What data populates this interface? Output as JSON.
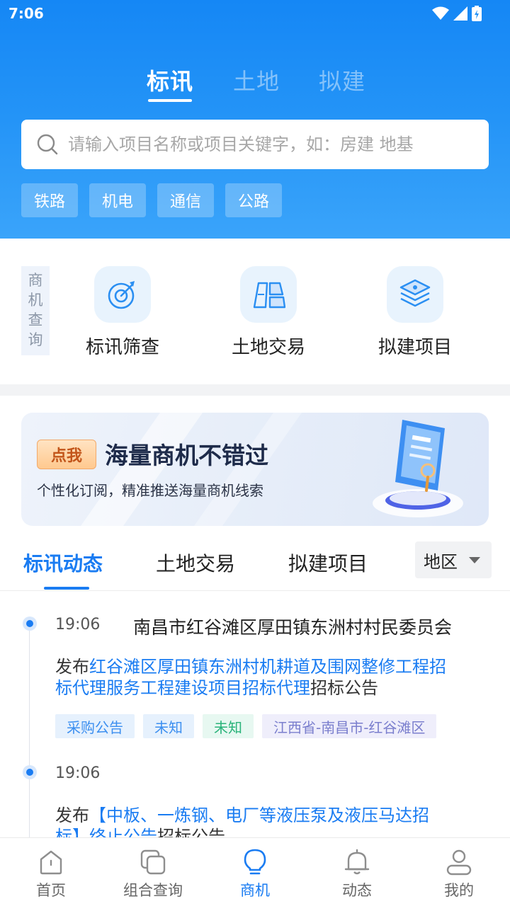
{
  "status_bar": {
    "time": "7:06"
  },
  "top_tabs": [
    {
      "label": "标讯",
      "active": true
    },
    {
      "label": "土地",
      "active": false
    },
    {
      "label": "拟建",
      "active": false
    }
  ],
  "search": {
    "placeholder": "请输入项目名称或项目关键字，如：房建 地基",
    "icon": "search-icon"
  },
  "chips": [
    "铁路",
    "机电",
    "通信",
    "公路"
  ],
  "biz_query": {
    "section_label": "商机查询",
    "features": [
      {
        "label": "标讯筛查",
        "icon": "target-icon"
      },
      {
        "label": "土地交易",
        "icon": "land-blocks-icon"
      },
      {
        "label": "拟建项目",
        "icon": "layers-icon"
      }
    ]
  },
  "banner": {
    "badge": "点我",
    "title": "海量商机不错过",
    "subtitle": "个性化订阅，精准推送海量商机线索"
  },
  "content_tabs": [
    {
      "label": "标讯动态",
      "active": true
    },
    {
      "label": "土地交易",
      "active": false
    },
    {
      "label": "拟建项目",
      "active": false
    }
  ],
  "region_filter": {
    "label": "地区"
  },
  "feed": [
    {
      "time": "19:06",
      "org": "南昌市红谷滩区厚田镇东洲村村民委员会",
      "desc_prefix": "发布",
      "desc_link_line1": "红谷滩区厚田镇东洲村机耕道及围网整修工程招",
      "desc_link_line2": "标代理服务工程建设项目招标代理",
      "desc_suffix": "招标公告",
      "tags": [
        "采购公告",
        "未知",
        "未知",
        "江西省-南昌市-红谷滩区"
      ]
    },
    {
      "time": "19:06",
      "org": "",
      "desc_prefix": "发布",
      "desc_link_line1": "【中板、一炼钢、电厂等液压泵及液压马达招",
      "desc_link_line2": "标】终止公告",
      "desc_suffix": "招标公告"
    }
  ],
  "bottom_nav": [
    {
      "label": "首页",
      "icon": "home-icon",
      "active": false
    },
    {
      "label": "组合查询",
      "icon": "combo-query-icon",
      "active": false
    },
    {
      "label": "商机",
      "icon": "lightbulb-icon",
      "active": true
    },
    {
      "label": "动态",
      "icon": "bell-icon",
      "active": false
    },
    {
      "label": "我的",
      "icon": "user-icon",
      "active": false
    }
  ],
  "colors": {
    "accent": "#1a7cf2",
    "header_top": "#1587f5",
    "header_bottom": "#3aa4fa"
  }
}
